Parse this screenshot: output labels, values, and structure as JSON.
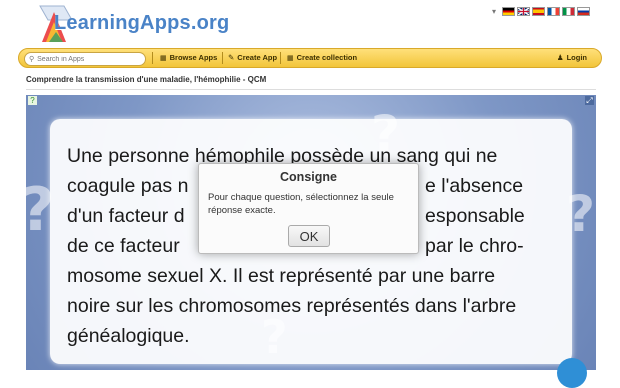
{
  "header": {
    "brand": "LearningApps.org",
    "language_chevron": "▾",
    "flags": [
      {
        "icon": "flag-germany-icon"
      },
      {
        "icon": "flag-uk-icon"
      },
      {
        "icon": "flag-spain-icon"
      },
      {
        "icon": "flag-france-icon"
      },
      {
        "icon": "flag-italy-icon"
      },
      {
        "icon": "flag-russia-icon"
      }
    ]
  },
  "toolbar": {
    "search_placeholder": "Search in Apps",
    "browse_label": "Browse Apps",
    "create_label": "Create App",
    "collection_label": "Create collection",
    "login_label": "Login"
  },
  "page": {
    "title": "Comprendre la transmission d'une maladie, l'hémophilie - QCM"
  },
  "exercise": {
    "question_text": "Une personne hémophile possède un sang qui ne coagule pas normalement en raison de l'absence d'un facteur de coagulation. Le gène responsable de ce facteur est porté par le chromosome sexuel X. Il est représenté par une barre noire sur les chromosomes représentés dans l'arbre généalogique.",
    "visible_lines": [
      "Une personne hémophile possède un sang qui ne",
      "coagule pas n",
      "e l'absence",
      "d'un facteur d",
      "esponsable",
      "de ce facteur",
      "par le chro-",
      "mosome sexuel X. Il est représenté par une barre",
      "noire sur les chromosomes représentés dans l'arbre",
      "généalogique."
    ]
  },
  "dialog": {
    "title": "Consigne",
    "message": "Pour chaque question, sélectionnez la seule réponse exacte.",
    "ok_label": "OK"
  },
  "colors": {
    "brand_blue": "#4a83c7",
    "toolbar_yellow": "#f2c53a",
    "stage_blue": "#7e97c6",
    "fab_blue": "#2f8fd6"
  }
}
